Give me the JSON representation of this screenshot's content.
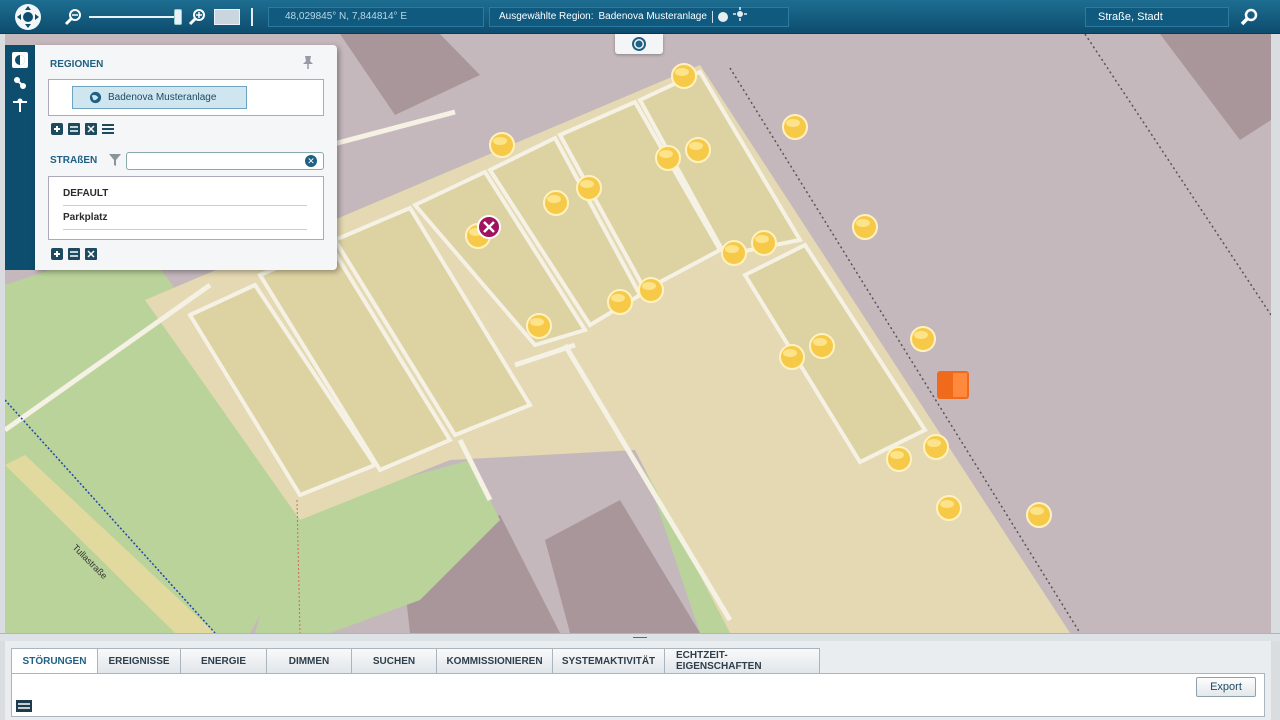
{
  "topbar": {
    "coordinates": "48,029845° N,  7,844814° E",
    "selected_region_label": "Ausgewählte Region:",
    "selected_region_value": "Badenova Musteranlage",
    "search_placeholder": "Straße, Stadt"
  },
  "map": {
    "street_label": "Tullastraße",
    "colors": {
      "background": "#c5b8bd",
      "field": "#ddd2a2",
      "grass": "#b9d39a",
      "building": "#a9969b",
      "path": "#f5f1e4",
      "light": "#f7c948",
      "marker": "#a0135f",
      "device": "#f06a1c"
    }
  },
  "panel": {
    "regions_header": "REGIONEN",
    "region_item": "Badenova Musteranlage",
    "streets_header": "STRAßEN",
    "streets": [
      "DEFAULT",
      "Parkplatz"
    ]
  },
  "bottom": {
    "tabs": [
      "STÖRUNGEN",
      "EREIGNISSE",
      "ENERGIE",
      "DIMMEN",
      "SUCHEN",
      "KOMMISSIONIEREN",
      "SYSTEMAKTIVITÄT",
      "ECHTZEIT-EIGENSCHAFTEN"
    ],
    "export_label": "Export"
  }
}
